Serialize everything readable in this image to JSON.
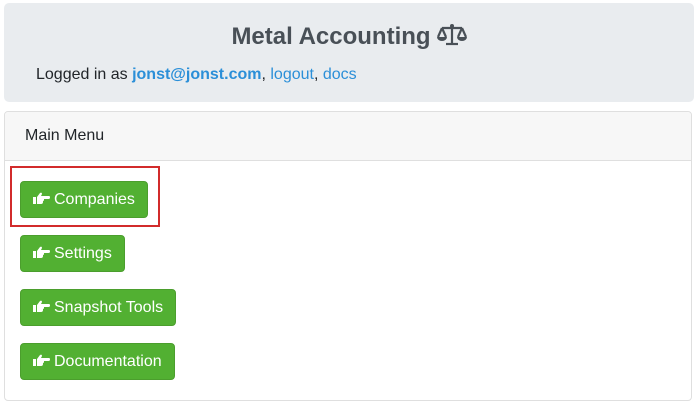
{
  "header": {
    "title": "Metal Accounting",
    "title_icon": "scale-balance-icon",
    "logged_in_prefix": "Logged in as ",
    "user_email": "jonst@jonst.com",
    "separator_1": ",",
    "logout_label": "logout",
    "separator_2": ",",
    "docs_label": "docs",
    "link_color": "#2b8fd8",
    "background": "#e9ecef"
  },
  "main_menu": {
    "title": "Main Menu",
    "buttons": [
      {
        "label": "Companies",
        "icon": "hand-point-right-icon"
      },
      {
        "label": "Settings",
        "icon": "hand-point-right-icon"
      },
      {
        "label": "Snapshot Tools",
        "icon": "hand-point-right-icon"
      },
      {
        "label": "Documentation",
        "icon": "hand-point-right-icon"
      }
    ],
    "button_color": "#52b032",
    "highlight_color": "#d22b2b"
  }
}
